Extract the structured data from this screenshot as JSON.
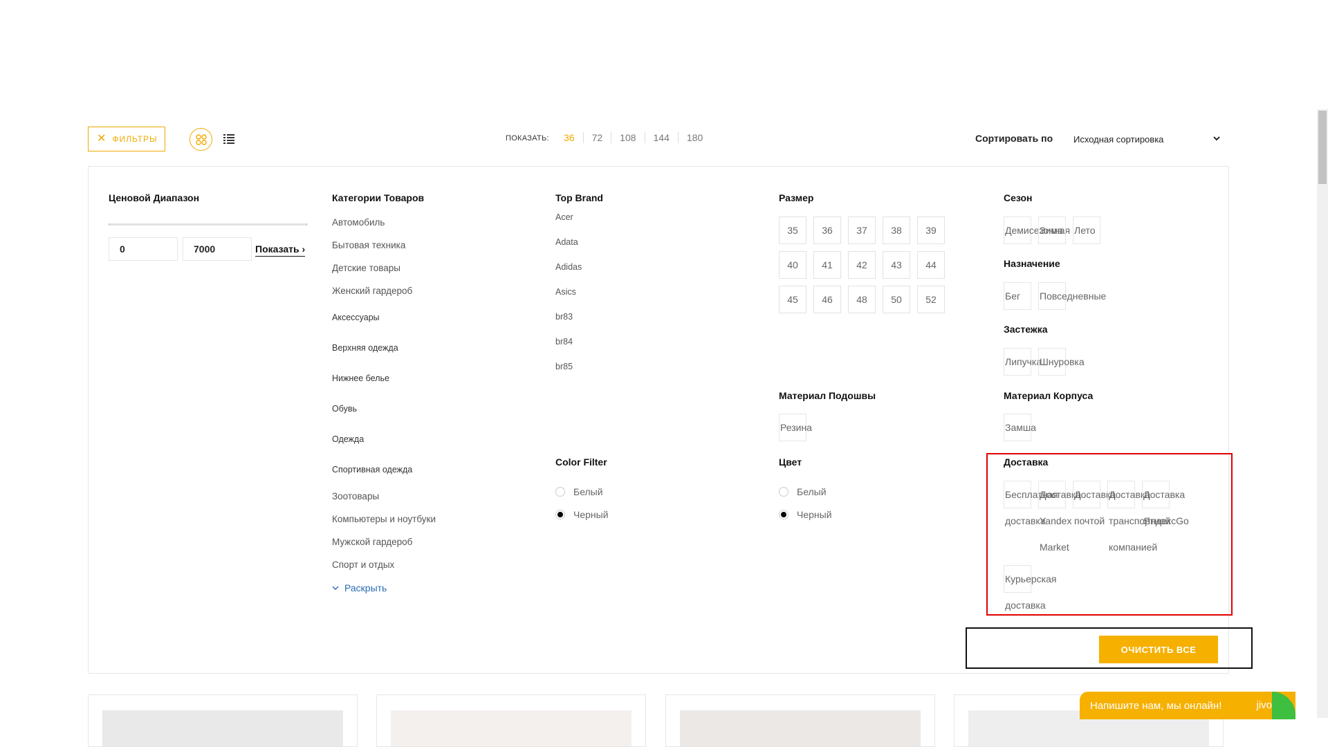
{
  "toolbar": {
    "filters_label": "ФИЛЬТРЫ",
    "show_label": "ПОКАЗАТЬ:",
    "per_page": [
      "36",
      "72",
      "108",
      "144",
      "180"
    ],
    "per_page_active": "36",
    "sort_label": "Сортировать по",
    "sort_value": "Исходная сортировка"
  },
  "price": {
    "title": "Ценовой Диапазон",
    "min": "0",
    "max": "7000",
    "show_button": "Показать"
  },
  "categories": {
    "title": "Категории Товаров",
    "items": [
      "Автомобиль",
      "Бытовая техника",
      "Детские товары",
      "Женский гардероб",
      "Аксессуары",
      "Верхняя одежда",
      "Нижнее белье",
      "Обувь",
      "Одежда",
      "Спортивная одежда",
      "Зоотовары",
      "Компьютеры и ноутбуки",
      "Мужской гардероб",
      "Спорт и отдых"
    ],
    "expand_label": "Раскрыть"
  },
  "brands": {
    "title": "Top Brand",
    "items": [
      "Acer",
      "Adata",
      "Adidas",
      "Asics",
      "br83",
      "br84",
      "br85"
    ]
  },
  "color_filter": {
    "title": "Color Filter",
    "options": [
      "Белый",
      "Черный"
    ],
    "selected": "Черный"
  },
  "sizes": {
    "title": "Размер",
    "items": [
      "35",
      "36",
      "37",
      "38",
      "39",
      "40",
      "41",
      "42",
      "43",
      "44",
      "45",
      "46",
      "48",
      "50",
      "52"
    ]
  },
  "sole": {
    "title": "Материал Подошвы",
    "items": [
      "Резина"
    ]
  },
  "color": {
    "title": "Цвет",
    "options": [
      "Белый",
      "Черный"
    ],
    "selected": "Черный"
  },
  "season": {
    "title": "Сезон",
    "items": [
      "Демисезонная",
      "Зима",
      "Лето"
    ]
  },
  "purpose": {
    "title": "Назначение",
    "items": [
      "Бег",
      "Повседневные"
    ]
  },
  "fastener": {
    "title": "Застежка",
    "items": [
      "Липучка",
      "Шнуровка"
    ]
  },
  "body_material": {
    "title": "Материал Корпуса",
    "items": [
      "Замша"
    ]
  },
  "delivery": {
    "title": "Доставка",
    "items": [
      {
        "line1": "Бесплатная",
        "line2": "доставка"
      },
      {
        "line1": "Доставка",
        "line2": "Yandex",
        "line3": "Market"
      },
      {
        "line1": "Доставка",
        "line2": "почтой"
      },
      {
        "line1": "Доставка",
        "line2": "транспортной",
        "line3": "компанией"
      },
      {
        "line1": "Доставка",
        "line2": "ЯндексGo"
      },
      {
        "line1": "Курьерская",
        "line2": "доставка"
      }
    ]
  },
  "clear_all": "ОЧИСТИТЬ ВСЕ",
  "chat": {
    "text": "Напишите нам, мы онлайн!",
    "brand": "jivo"
  },
  "colors": {
    "accent": "#f6b000",
    "highlight_red": "#e00000",
    "link_blue": "#2a6db5"
  }
}
